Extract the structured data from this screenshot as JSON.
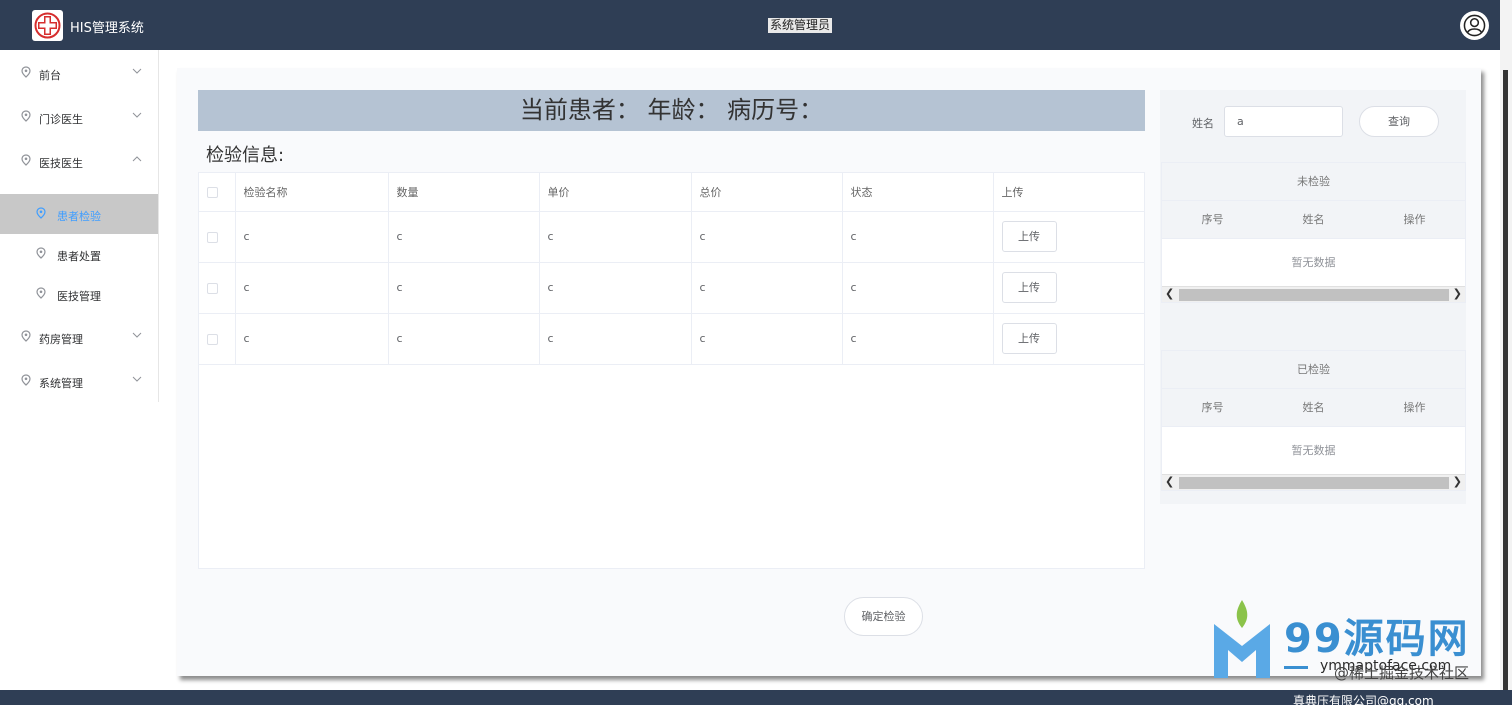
{
  "header": {
    "app_title": "HIS管理系统",
    "role": "系统管理员"
  },
  "sidebar": {
    "items": [
      {
        "label": "前台"
      },
      {
        "label": "门诊医生"
      },
      {
        "label": "医技医生"
      },
      {
        "label": "患者检验"
      },
      {
        "label": "患者处置"
      },
      {
        "label": "医技管理"
      },
      {
        "label": "药房管理"
      },
      {
        "label": "系统管理"
      }
    ]
  },
  "main": {
    "patient_bar": "当前患者： 年龄： 病历号：",
    "section_title": "检验信息:",
    "columns": [
      "检验名称",
      "数量",
      "单价",
      "总价",
      "状态",
      "上传"
    ],
    "rows": [
      {
        "name": "c",
        "qty": "c",
        "price": "c",
        "total": "c",
        "status": "c",
        "upload": "上传"
      },
      {
        "name": "c",
        "qty": "c",
        "price": "c",
        "total": "c",
        "status": "c",
        "upload": "上传"
      },
      {
        "name": "c",
        "qty": "c",
        "price": "c",
        "total": "c",
        "status": "c",
        "upload": "上传"
      }
    ],
    "confirm_button": "确定检验"
  },
  "search": {
    "label": "姓名",
    "value": "a",
    "query_button": "查询"
  },
  "unchecked_table": {
    "caption": "未检验",
    "columns": [
      "序号",
      "姓名",
      "操作"
    ],
    "empty_text": "暂无数据"
  },
  "checked_table": {
    "caption": "已检验",
    "columns": [
      "序号",
      "姓名",
      "操作"
    ],
    "empty_text": "暂无数据"
  },
  "footer": {
    "text": "真典压有限公司@qq.com"
  },
  "watermark": {
    "brand": "99源码网",
    "sub_a": "ymmaptoface.com",
    "sub_b": "@稀土掘金技术社区"
  },
  "colors": {
    "header_bg": "#2f3e55",
    "accent": "#409eff",
    "patient_bar_bg": "#b5c3d3"
  }
}
